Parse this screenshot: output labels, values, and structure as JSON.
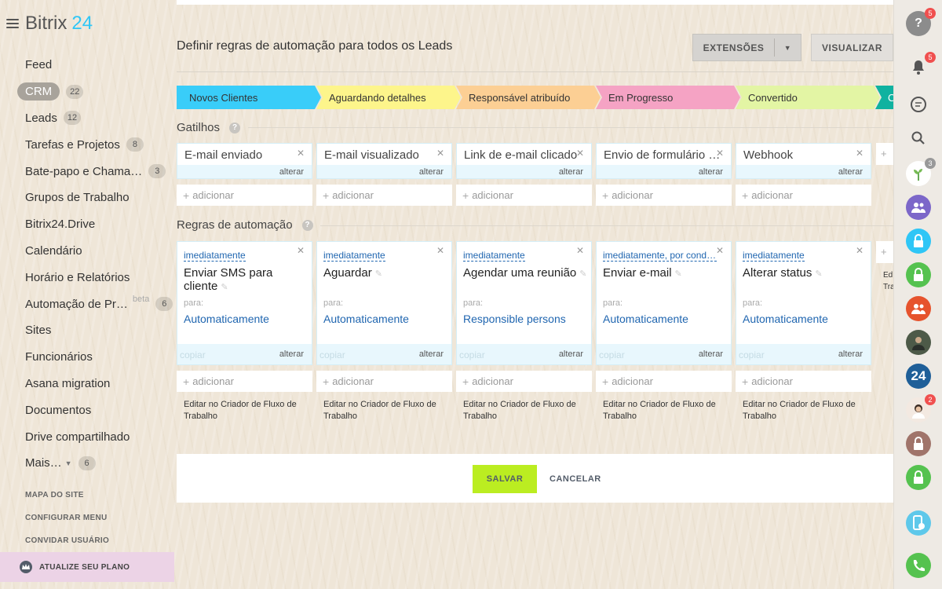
{
  "app": {
    "logo_main": "Bitrix",
    "logo_num": "24"
  },
  "sidebar": {
    "items": [
      {
        "label": "Feed",
        "count": ""
      },
      {
        "label": "CRM",
        "count": "22",
        "active": true
      },
      {
        "label": "Leads",
        "count": "12"
      },
      {
        "label": "Tarefas e Projetos",
        "count": "8"
      },
      {
        "label": "Bate-papo e Chama…",
        "count": "3"
      },
      {
        "label": "Grupos de Trabalho",
        "count": ""
      },
      {
        "label": "Bitrix24.Drive",
        "count": ""
      },
      {
        "label": "Calendário",
        "count": ""
      },
      {
        "label": "Horário e Relatórios",
        "count": ""
      },
      {
        "label": "Automação de Pr…",
        "count": "6",
        "beta": "beta"
      },
      {
        "label": "Sites",
        "count": ""
      },
      {
        "label": "Funcionários",
        "count": ""
      },
      {
        "label": "Asana migration",
        "count": ""
      },
      {
        "label": "Documentos",
        "count": ""
      },
      {
        "label": "Drive compartilhado",
        "count": ""
      },
      {
        "label": "Mais…",
        "count": "6",
        "caret": true
      }
    ],
    "links": [
      "MAPA DO SITE",
      "CONFIGURAR MENU",
      "CONVIDAR USUÁRIO"
    ],
    "upgrade": "ATUALIZE SEU PLANO"
  },
  "header": {
    "title": "Definir regras de automação para todos os Leads",
    "extensions": "EXTENSÕES",
    "preview": "VISUALIZAR"
  },
  "stages": [
    {
      "label": "Novos Clientes",
      "color": "#39cdf9"
    },
    {
      "label": "Aguardando detalhes",
      "color": "#fdf58b"
    },
    {
      "label": "Responsável atribuído",
      "color": "#fccf94"
    },
    {
      "label": "Em Progresso",
      "color": "#f5a3c4"
    },
    {
      "label": "Convertido",
      "color": "#e3f5a4"
    },
    {
      "label": "C",
      "color": "#10b2a0"
    }
  ],
  "triggers": {
    "title": "Gatilhos",
    "help": "?",
    "cards": [
      {
        "name": "E-mail enviado",
        "edit": "alterar"
      },
      {
        "name": "E-mail visualizado",
        "edit": "alterar"
      },
      {
        "name": "Link de e-mail clicado",
        "edit": "alterar"
      },
      {
        "name": "Envio de formulário d…",
        "edit": "alterar"
      },
      {
        "name": "Webhook",
        "edit": "alterar"
      }
    ],
    "add": "adicionar"
  },
  "rules": {
    "title": "Regras de automação",
    "help": "?",
    "cards": [
      {
        "when": "imediatamente",
        "name": "Enviar SMS para cliente",
        "for": "para:",
        "to": "Automaticamente",
        "copy": "copiar",
        "edit": "alterar"
      },
      {
        "when": "imediatamente",
        "name": "Aguardar",
        "for": "para:",
        "to": "Automaticamente",
        "copy": "copiar",
        "edit": "alterar"
      },
      {
        "when": "imediatamente",
        "name": "Agendar uma reunião",
        "for": "para:",
        "to": "Responsible persons",
        "copy": "copiar",
        "edit": "alterar"
      },
      {
        "when": "imediatamente, por condi…",
        "name": "Enviar e-mail",
        "for": "para:",
        "to": "Automaticamente",
        "copy": "copiar",
        "edit": "alterar"
      },
      {
        "when": "imediatamente",
        "name": "Alterar status",
        "for": "para:",
        "to": "Automaticamente",
        "copy": "copiar",
        "edit": "alterar"
      }
    ],
    "add": "adicionar",
    "designer_link": "Editar no Criador de Fluxo de Trabalho",
    "partial_label": "Ed Tra"
  },
  "footer": {
    "save": "SALVAR",
    "cancel": "CANCELAR"
  },
  "rightbar": {
    "help_badge": "5",
    "notif_badge": "5",
    "avatar1_badge": "3",
    "avatar2_badge": "2",
    "logo24": "24"
  }
}
